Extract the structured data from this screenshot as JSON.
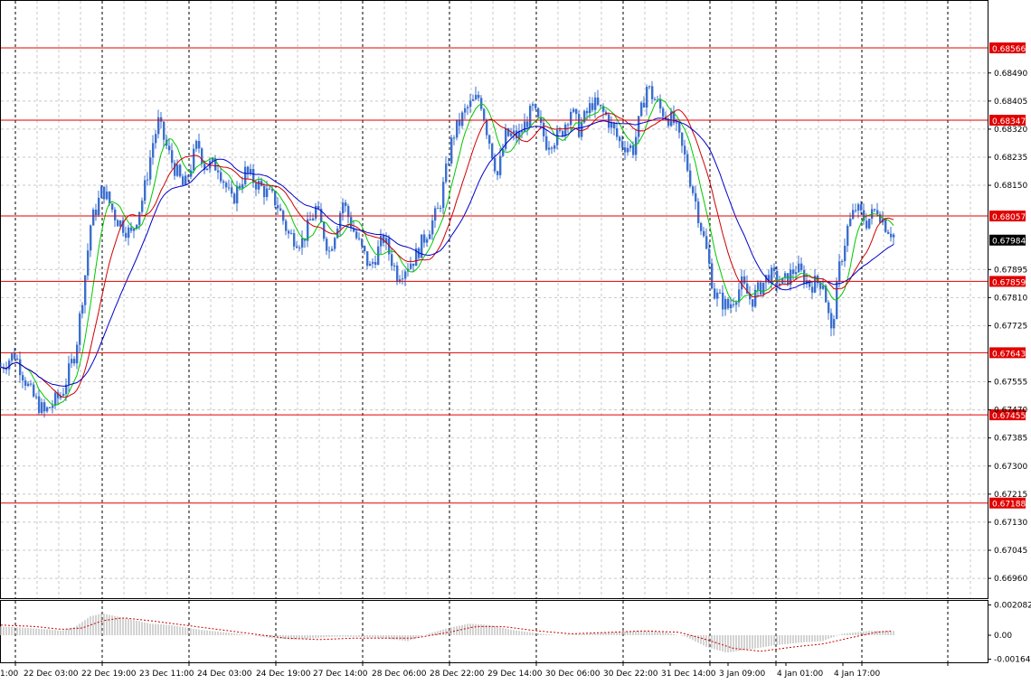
{
  "chart_data": [
    {
      "type": "candlestick",
      "title": "",
      "ylim": [
        0.669,
        0.687
      ],
      "y_ticks": [
        "0.68490",
        "0.68405",
        "0.68320",
        "0.68235",
        "0.68150",
        "0.67895",
        "0.67810",
        "0.67725",
        "0.67555",
        "0.67470",
        "0.67385",
        "0.67300",
        "0.67215",
        "0.67130",
        "0.67045",
        "0.66960"
      ],
      "levels": [
        {
          "label": "0.68566",
          "value": 0.68566
        },
        {
          "label": "0.68347",
          "value": 0.68347
        },
        {
          "label": "0.68057",
          "value": 0.68057
        },
        {
          "label": "0.67859",
          "value": 0.67859
        },
        {
          "label": "0.67643",
          "value": 0.67643
        },
        {
          "label": "0.67455",
          "value": 0.67455
        },
        {
          "label": "0.67188",
          "value": 0.67188
        }
      ],
      "current_price": {
        "label": "0.67984",
        "value": 0.67984
      },
      "time_labels": [
        "1:00",
        "22 Dec 03:00",
        "22 Dec 19:00",
        "23 Dec 11:00",
        "24 Dec 03:00",
        "24 Dec 19:00",
        "27 Dec 14:00",
        "28 Dec 06:00",
        "28 Dec 22:00",
        "29 Dec 14:00",
        "30 Dec 06:00",
        "30 Dec 22:00",
        "31 Dec 14:00",
        "3 Jan 09:00",
        "4 Jan 01:00",
        "4 Jan 17:00"
      ],
      "bar_count": 330,
      "price_path": [
        [
          0,
          0.676
        ],
        [
          10,
          0.6764
        ],
        [
          22,
          0.6752
        ],
        [
          32,
          0.6746
        ],
        [
          45,
          0.6752
        ],
        [
          55,
          0.6765
        ],
        [
          62,
          0.6788
        ],
        [
          66,
          0.6803
        ],
        [
          75,
          0.6814
        ],
        [
          85,
          0.6805
        ],
        [
          96,
          0.68
        ],
        [
          105,
          0.6812
        ],
        [
          112,
          0.6828
        ],
        [
          116,
          0.6834
        ],
        [
          125,
          0.6823
        ],
        [
          135,
          0.6814
        ],
        [
          145,
          0.6828
        ],
        [
          150,
          0.6821
        ],
        [
          160,
          0.6821
        ],
        [
          170,
          0.681
        ],
        [
          180,
          0.6819
        ],
        [
          195,
          0.6813
        ],
        [
          203,
          0.681
        ],
        [
          212,
          0.68
        ],
        [
          222,
          0.6798
        ],
        [
          232,
          0.6808
        ],
        [
          242,
          0.6795
        ],
        [
          252,
          0.681
        ],
        [
          262,
          0.6799
        ],
        [
          272,
          0.679
        ],
        [
          282,
          0.6799
        ],
        [
          292,
          0.6788
        ],
        [
          305,
          0.6793
        ],
        [
          313,
          0.68
        ],
        [
          323,
          0.6808
        ],
        [
          333,
          0.683
        ],
        [
          343,
          0.6838
        ],
        [
          353,
          0.6842
        ],
        [
          358,
          0.6832
        ],
        [
          366,
          0.6818
        ],
        [
          372,
          0.683
        ],
        [
          382,
          0.683
        ],
        [
          392,
          0.6838
        ],
        [
          402,
          0.6828
        ],
        [
          412,
          0.683
        ],
        [
          420,
          0.6838
        ],
        [
          426,
          0.6832
        ],
        [
          436,
          0.684
        ],
        [
          446,
          0.6836
        ],
        [
          456,
          0.6828
        ],
        [
          466,
          0.6826
        ],
        [
          476,
          0.6845
        ],
        [
          486,
          0.6838
        ],
        [
          496,
          0.6834
        ],
        [
          505,
          0.6822
        ],
        [
          512,
          0.681
        ],
        [
          520,
          0.6795
        ],
        [
          526,
          0.6782
        ],
        [
          536,
          0.6778
        ],
        [
          546,
          0.6785
        ],
        [
          553,
          0.678
        ],
        [
          566,
          0.6788
        ],
        [
          576,
          0.6785
        ],
        [
          586,
          0.679
        ],
        [
          596,
          0.6785
        ],
        [
          606,
          0.6786
        ],
        [
          612,
          0.677
        ],
        [
          618,
          0.679
        ],
        [
          624,
          0.6802
        ],
        [
          630,
          0.6808
        ],
        [
          638,
          0.6804
        ],
        [
          646,
          0.6808
        ],
        [
          652,
          0.6803
        ],
        [
          658,
          0.68
        ]
      ],
      "ma_fast_color": "#00c800",
      "ma_mid_color": "#cc0000",
      "ma_slow_color": "#0000cc",
      "candle_color": "#3b6fcf",
      "level_color": "#e00000"
    },
    {
      "type": "histogram",
      "title": "",
      "ylim": [
        -0.0018,
        0.0023
      ],
      "y_ticks": [
        "0.002082",
        "0.00",
        "-0.001648"
      ],
      "histogram_path": [
        [
          0,
          0.0006
        ],
        [
          20,
          0.0005
        ],
        [
          35,
          0.0004
        ],
        [
          45,
          0.0003
        ],
        [
          55,
          0.0006
        ],
        [
          66,
          0.0013
        ],
        [
          75,
          0.0015
        ],
        [
          90,
          0.0012
        ],
        [
          100,
          0.001
        ],
        [
          110,
          0.0008
        ],
        [
          125,
          0.0007
        ],
        [
          145,
          0.0004
        ],
        [
          165,
          0.0002
        ],
        [
          185,
          0.0
        ],
        [
          200,
          -0.0002
        ],
        [
          215,
          -0.0003
        ],
        [
          230,
          -0.0002
        ],
        [
          245,
          -0.0001
        ],
        [
          262,
          -0.0001
        ],
        [
          280,
          -0.0002
        ],
        [
          300,
          -0.0004
        ],
        [
          315,
          0.0001
        ],
        [
          330,
          0.0005
        ],
        [
          345,
          0.0008
        ],
        [
          360,
          0.0007
        ],
        [
          375,
          0.0004
        ],
        [
          390,
          0.0002
        ],
        [
          410,
          0.0
        ],
        [
          430,
          0.0001
        ],
        [
          450,
          0.0002
        ],
        [
          470,
          0.0003
        ],
        [
          490,
          0.0002
        ],
        [
          505,
          -0.0001
        ],
        [
          520,
          -0.0008
        ],
        [
          535,
          -0.0012
        ],
        [
          550,
          -0.001
        ],
        [
          570,
          -0.0007
        ],
        [
          590,
          -0.0005
        ],
        [
          606,
          -0.0004
        ],
        [
          620,
          0.0001
        ],
        [
          640,
          0.0003
        ],
        [
          658,
          0.0003
        ]
      ],
      "signal_path": [
        [
          0,
          0.0007
        ],
        [
          25,
          0.0006
        ],
        [
          45,
          0.0004
        ],
        [
          60,
          0.0005
        ],
        [
          75,
          0.001
        ],
        [
          90,
          0.0012
        ],
        [
          110,
          0.001
        ],
        [
          135,
          0.0007
        ],
        [
          160,
          0.0004
        ],
        [
          185,
          0.0001
        ],
        [
          210,
          -0.0002
        ],
        [
          235,
          -0.0003
        ],
        [
          260,
          -0.0002
        ],
        [
          285,
          -0.0002
        ],
        [
          305,
          -0.0002
        ],
        [
          330,
          0.0002
        ],
        [
          350,
          0.0006
        ],
        [
          370,
          0.0006
        ],
        [
          395,
          0.0003
        ],
        [
          420,
          0.0001
        ],
        [
          450,
          0.0002
        ],
        [
          475,
          0.0003
        ],
        [
          500,
          0.0002
        ],
        [
          520,
          -0.0003
        ],
        [
          540,
          -0.0009
        ],
        [
          560,
          -0.0011
        ],
        [
          585,
          -0.0008
        ],
        [
          606,
          -0.0006
        ],
        [
          625,
          -0.0002
        ],
        [
          645,
          0.0002
        ],
        [
          658,
          0.0003
        ]
      ],
      "signal_color": "#cc0000",
      "histogram_color": "#c0c0c0"
    }
  ]
}
